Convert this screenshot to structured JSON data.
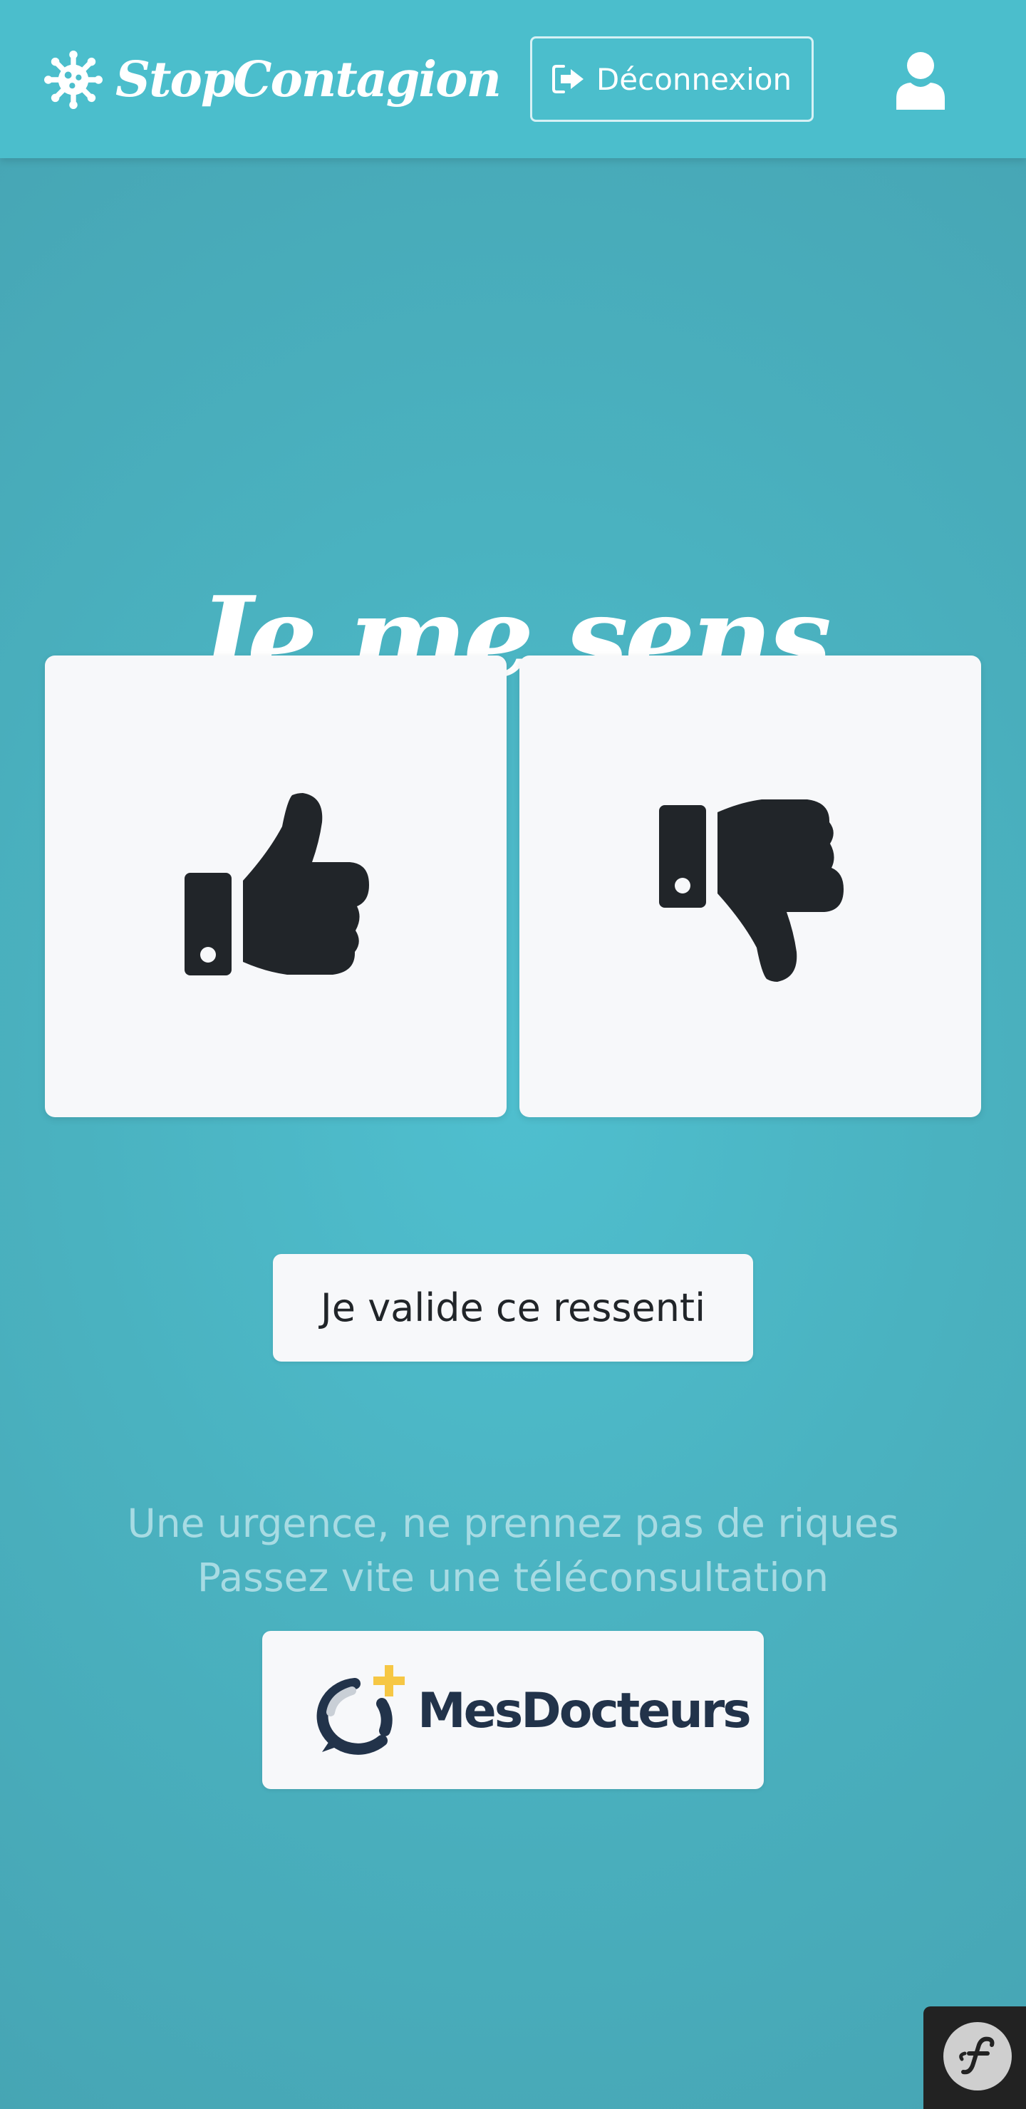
{
  "header": {
    "brand": "StopContagion",
    "brand_icon": "virus-icon",
    "logout_label": "Déconnexion",
    "logout_icon": "sign-out-icon",
    "user_icon": "user-icon"
  },
  "main": {
    "headline": "Je me sens",
    "mood_options": [
      {
        "name": "thumbs-up-icon",
        "meaning": "good"
      },
      {
        "name": "thumbs-down-icon",
        "meaning": "bad"
      }
    ],
    "validate_label": "Je valide ce ressenti"
  },
  "emergency": {
    "line1": "Une urgence, ne prennez pas de riques",
    "line2": "Passez vite une téléconsultation",
    "partner_text": "MesDocteurs"
  },
  "debug_toolbar": {
    "icon": "symfony-icon"
  },
  "colors": {
    "header_bg": "#4bbecc",
    "page_bg": "#4ab2c0",
    "card_bg": "#f7f8fa",
    "icon_dark": "#212529",
    "partner_navy": "#22334a",
    "partner_accent": "#f6c744",
    "muted_text": "#a7dbe3"
  }
}
